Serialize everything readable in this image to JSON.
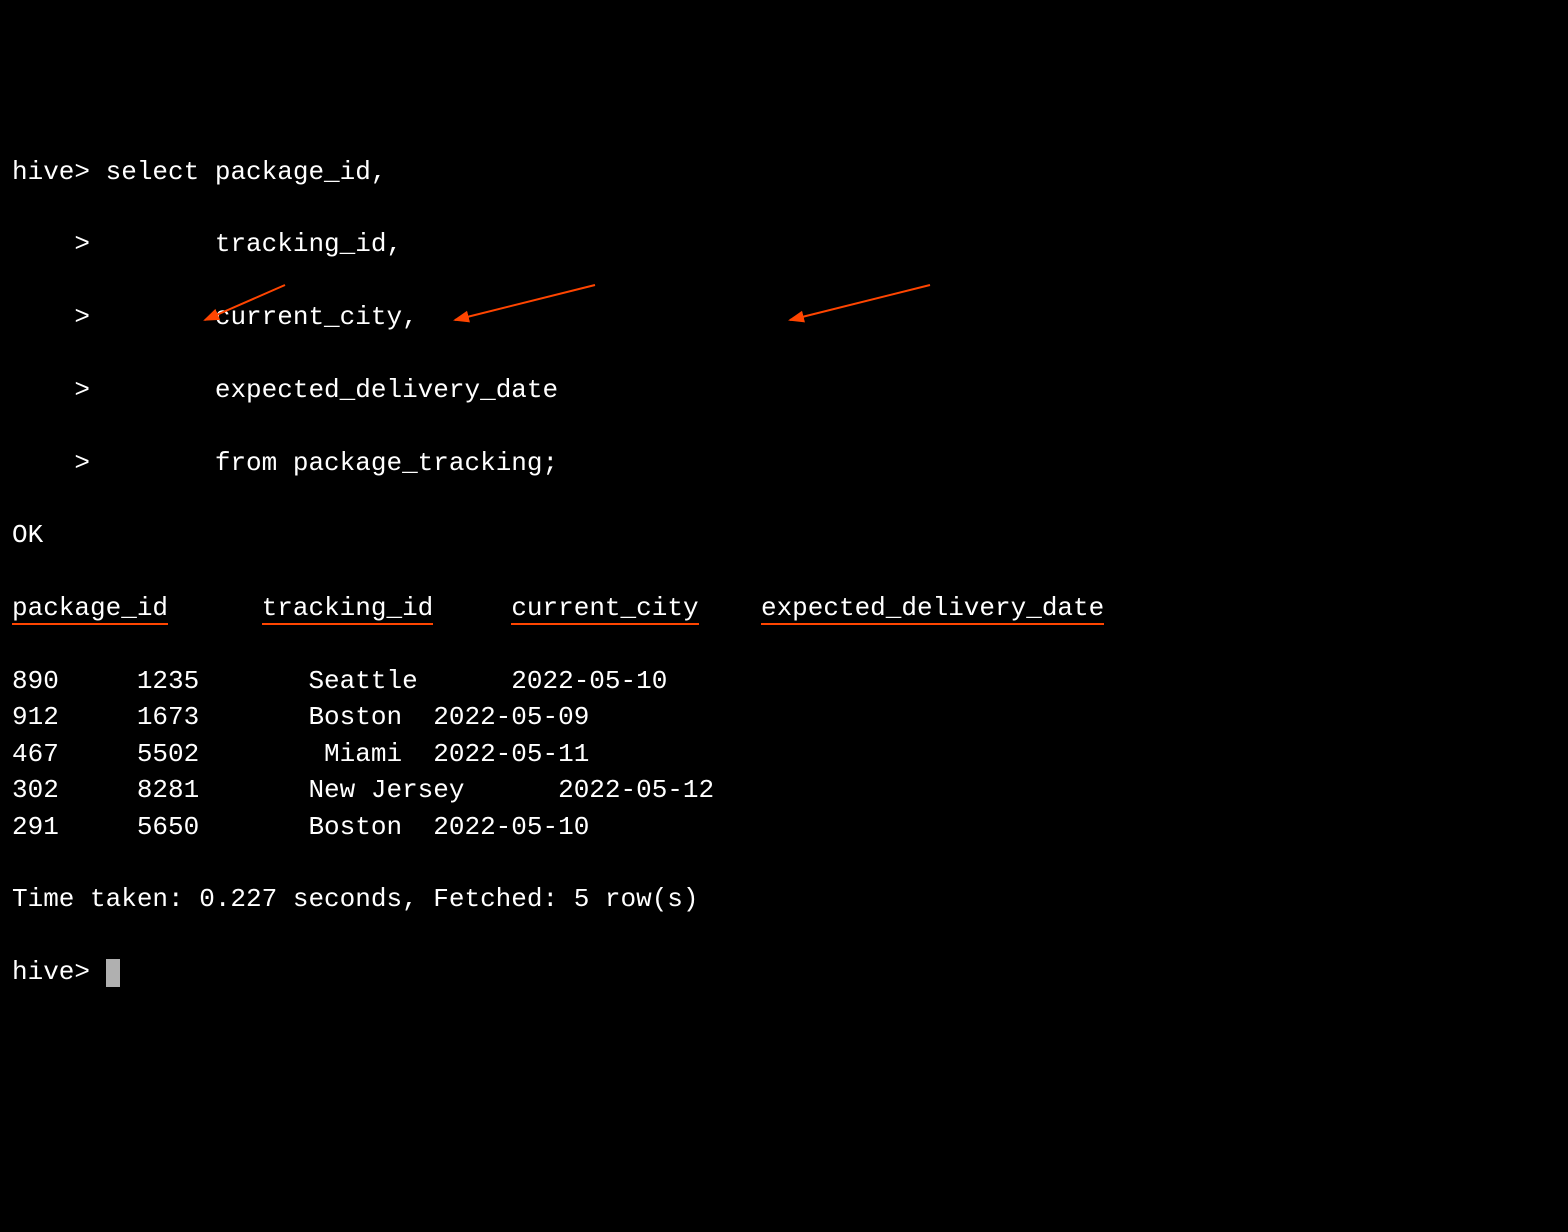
{
  "query": {
    "prompt": "hive>",
    "continuation": "    >",
    "lines": [
      "select package_id,",
      "       tracking_id,",
      "       current_city,",
      "       expected_delivery_date",
      "       from package_tracking;"
    ]
  },
  "ok": "OK",
  "headers": {
    "col1": "package_id",
    "col2": "tracking_id",
    "col3": "current_city",
    "col4": "expected_delivery_date"
  },
  "rows": [
    {
      "package_id": "890",
      "tracking_id": "1235",
      "current_city": "Seattle",
      "expected_delivery_date": "2022-05-10",
      "spacing": "large"
    },
    {
      "package_id": "912",
      "tracking_id": "1673",
      "current_city": "Boston",
      "expected_delivery_date": "2022-05-09",
      "spacing": "small"
    },
    {
      "package_id": "467",
      "tracking_id": "5502",
      "current_city": "Miami",
      "expected_delivery_date": "2022-05-11",
      "spacing": "small",
      "city_pad": " "
    },
    {
      "package_id": "302",
      "tracking_id": "8281",
      "current_city": "New Jersey",
      "expected_delivery_date": "2022-05-12",
      "spacing": "large"
    },
    {
      "package_id": "291",
      "tracking_id": "5650",
      "current_city": "Boston",
      "expected_delivery_date": "2022-05-10",
      "spacing": "small"
    }
  ],
  "footer": "Time taken: 0.227 seconds, Fetched: 5 row(s)",
  "final_prompt": "hive>"
}
